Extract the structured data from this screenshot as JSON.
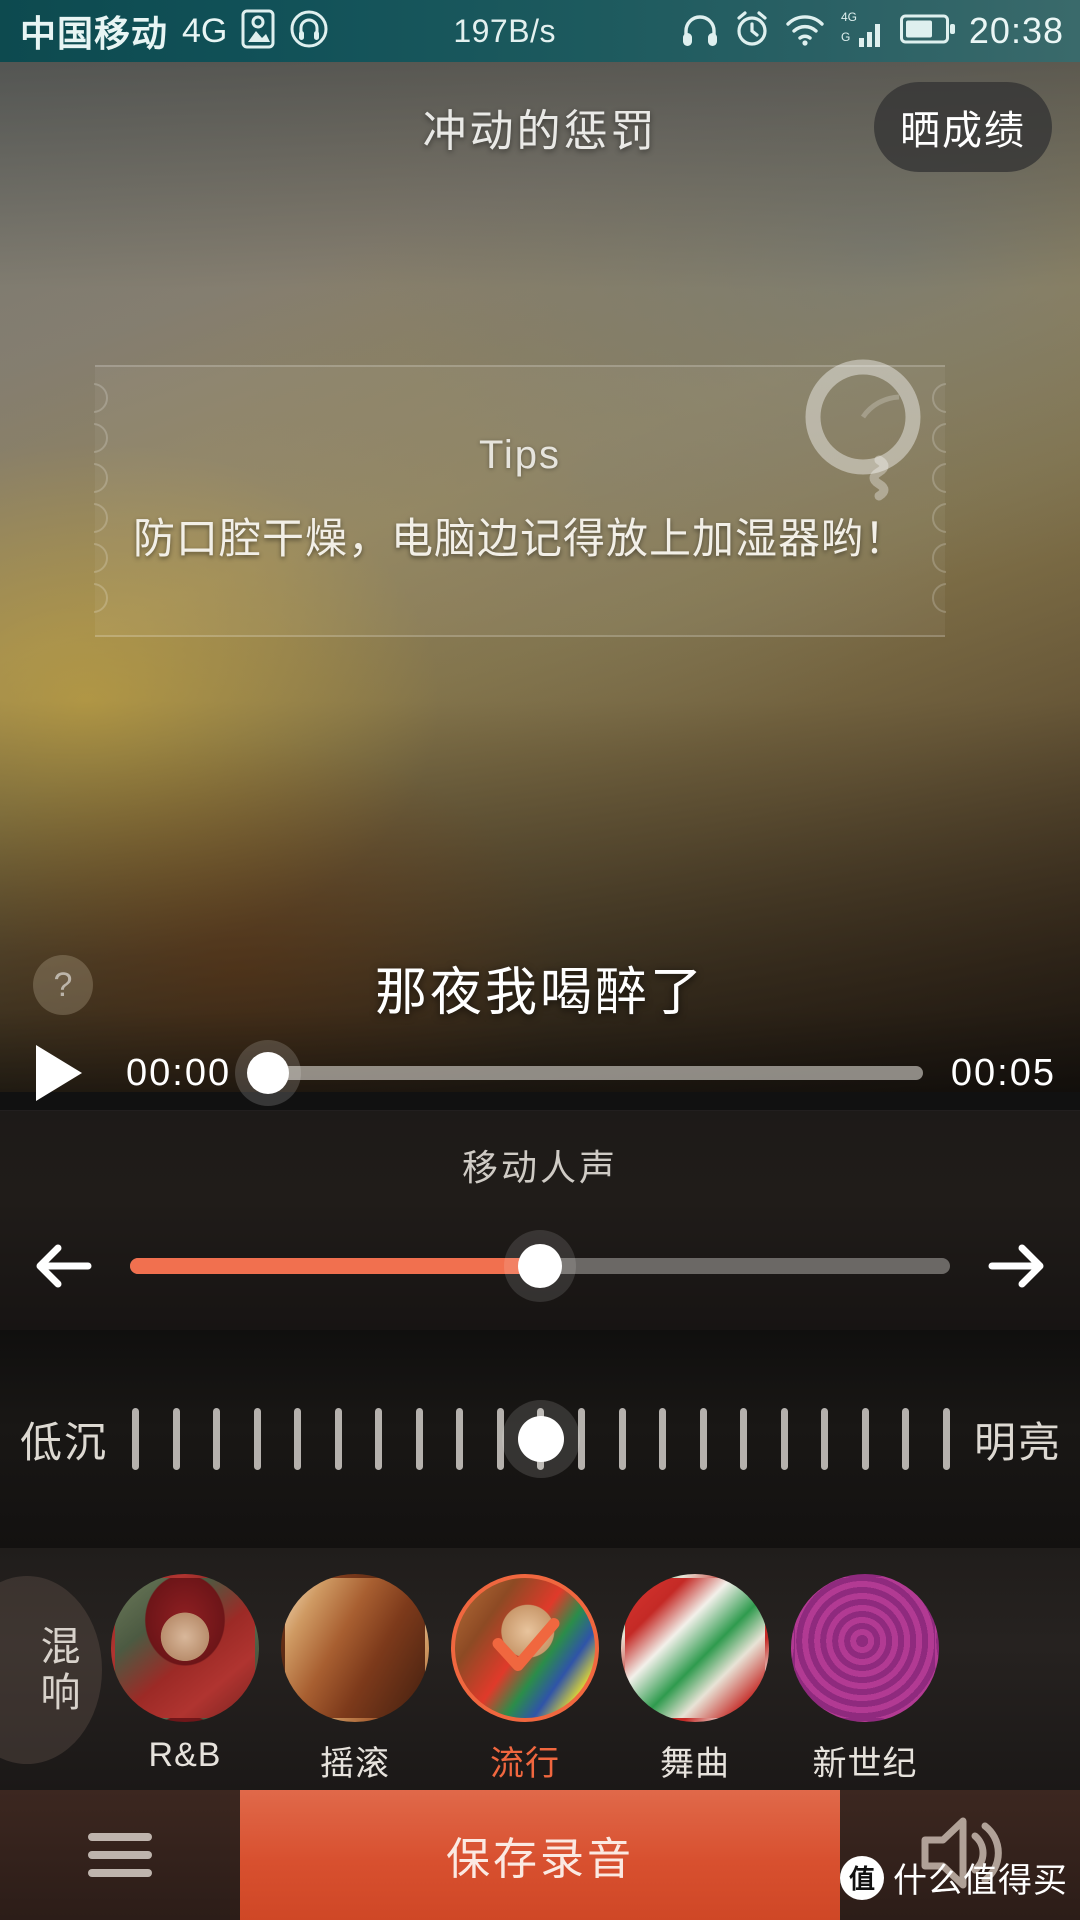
{
  "statusbar": {
    "carrier": "中国移动",
    "network": "4G",
    "speed": "197B/s",
    "time": "20:38",
    "icons_left": [
      "sim-card-icon",
      "headset-circle-icon"
    ],
    "icons_right": [
      "headphones-icon",
      "alarm-clock-icon",
      "wifi-icon",
      "signal-4g-icon",
      "battery-icon"
    ],
    "accent": "#155257"
  },
  "header": {
    "song_title": "冲动的惩罚",
    "share_label": "晒成绩"
  },
  "tips_card": {
    "label": "Tips",
    "text": "防口腔干燥，电脑边记得放上加湿器哟！",
    "ring_icon": "record-ring-icon"
  },
  "lyric": {
    "help_label": "?",
    "current_line": "那夜我喝醉了"
  },
  "player": {
    "play_icon": "play-icon",
    "current_time": "00:00",
    "total_time": "00:05",
    "progress_percent": 0
  },
  "vocal_panel": {
    "title": "移动人声",
    "left_icon": "arrow-left-icon",
    "right_icon": "arrow-right-icon",
    "value_percent": 50,
    "fill_color": "#f1704f"
  },
  "tone_panel": {
    "left_label": "低沉",
    "right_label": "明亮",
    "tick_count": 21,
    "value_index": 10
  },
  "effects_panel": {
    "side_label": "混响",
    "items": [
      {
        "name": "R&B",
        "art": "art-rb",
        "selected": false
      },
      {
        "name": "摇滚",
        "art": "art-rock",
        "selected": false
      },
      {
        "name": "流行",
        "art": "art-pop",
        "selected": true
      },
      {
        "name": "舞曲",
        "art": "art-dance",
        "selected": false
      },
      {
        "name": "新世纪",
        "art": "art-new",
        "selected": false
      }
    ],
    "selected_color": "#f0673f"
  },
  "bottom_bar": {
    "menu_icon": "hamburger-menu-icon",
    "save_label": "保存录音",
    "volume_icon": "speaker-icon",
    "save_color": "#d8502f"
  },
  "watermark": {
    "badge": "值",
    "text": "什么值得买"
  }
}
